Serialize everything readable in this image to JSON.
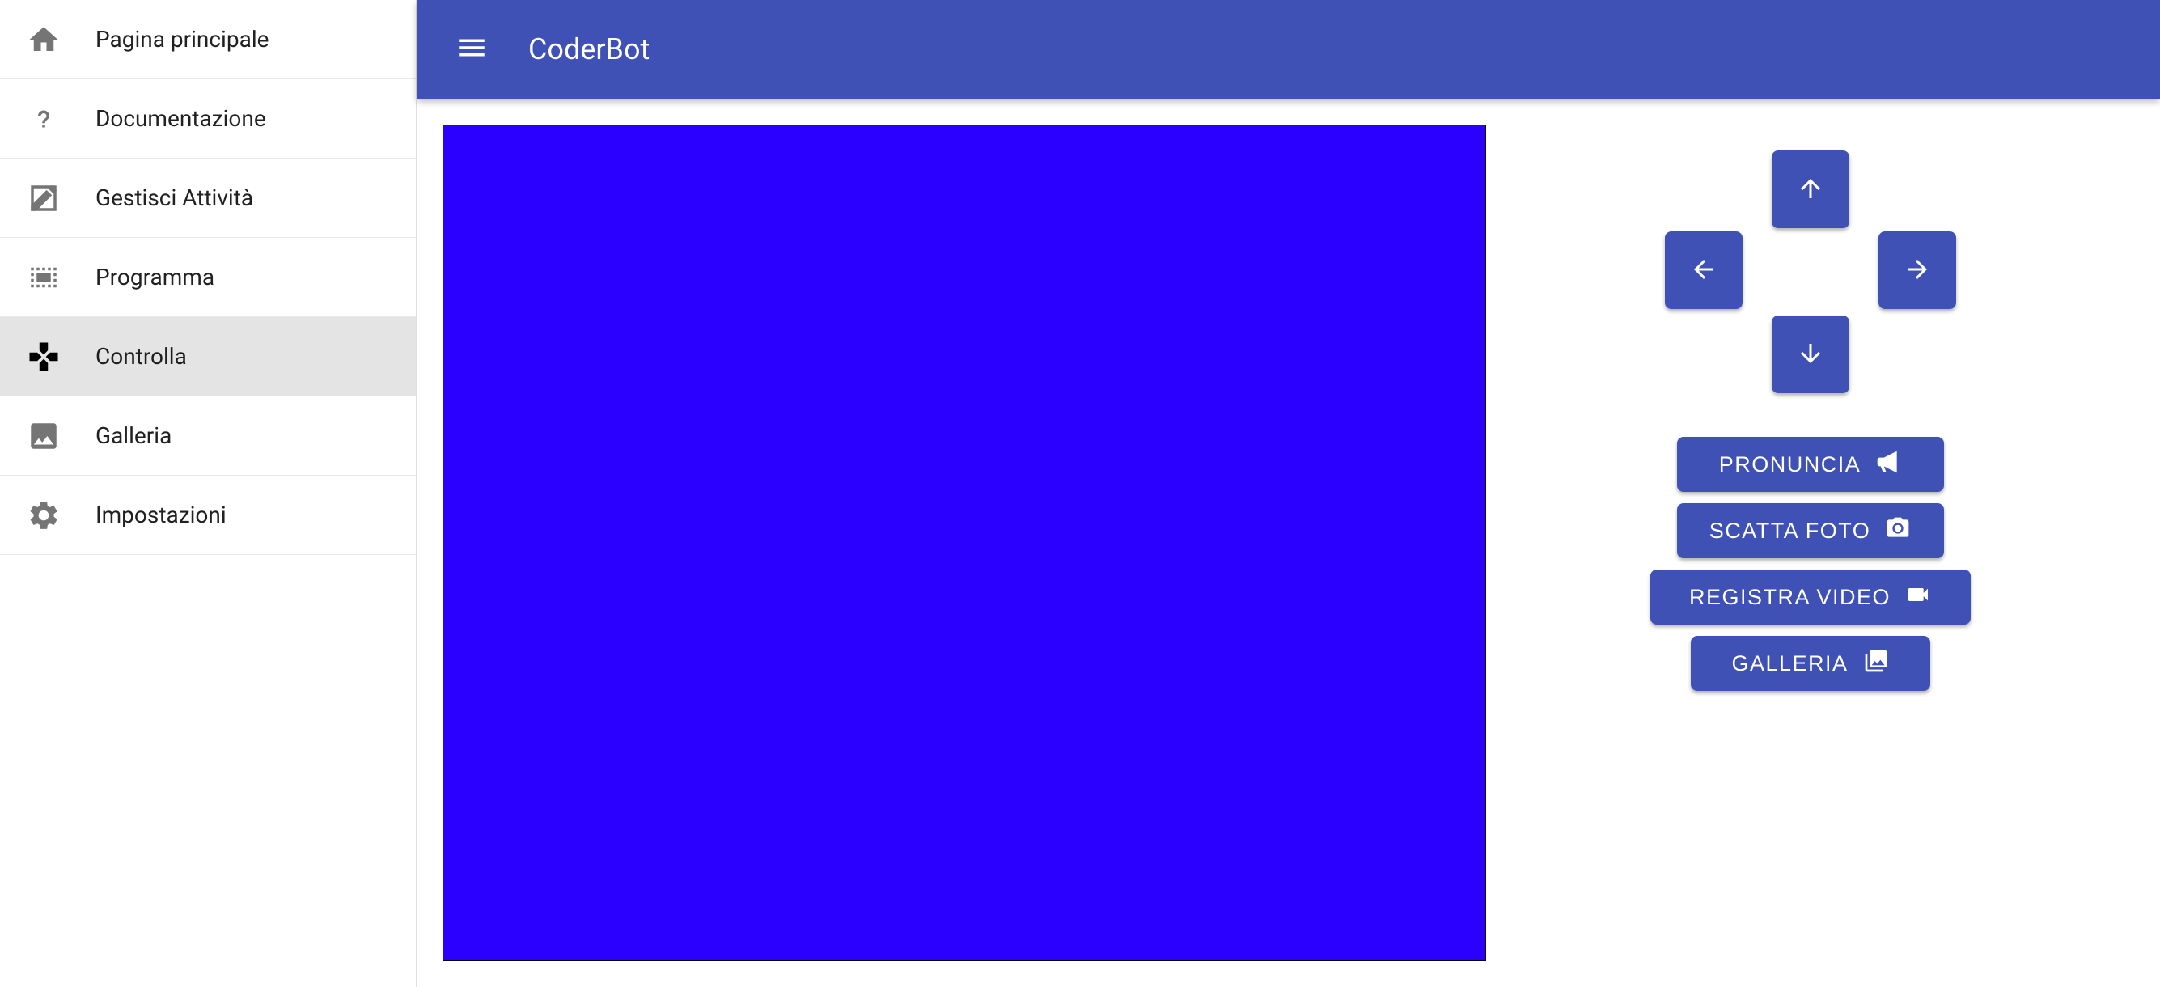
{
  "app": {
    "title": "CoderBot"
  },
  "sidebar": {
    "items": [
      {
        "label": "Pagina principale",
        "icon": "home"
      },
      {
        "label": "Documentazione",
        "icon": "help"
      },
      {
        "label": "Gestisci Attività",
        "icon": "edit"
      },
      {
        "label": "Programma",
        "icon": "visualize"
      },
      {
        "label": "Controlla",
        "icon": "gamepad",
        "active": true
      },
      {
        "label": "Galleria",
        "icon": "image"
      },
      {
        "label": "Impostazioni",
        "icon": "settings"
      }
    ]
  },
  "controls": {
    "dpad": {
      "up": "arrow-up",
      "left": "arrow-left",
      "right": "arrow-right",
      "down": "arrow-down"
    },
    "actions": [
      {
        "label": "PRONUNCIA",
        "icon": "bullhorn"
      },
      {
        "label": "SCATTA FOTO",
        "icon": "camera"
      },
      {
        "label": "REGISTRA VIDEO",
        "icon": "videocam"
      },
      {
        "label": "GALLERIA",
        "icon": "collections"
      }
    ]
  },
  "video": {
    "color": "#2b00ff"
  }
}
